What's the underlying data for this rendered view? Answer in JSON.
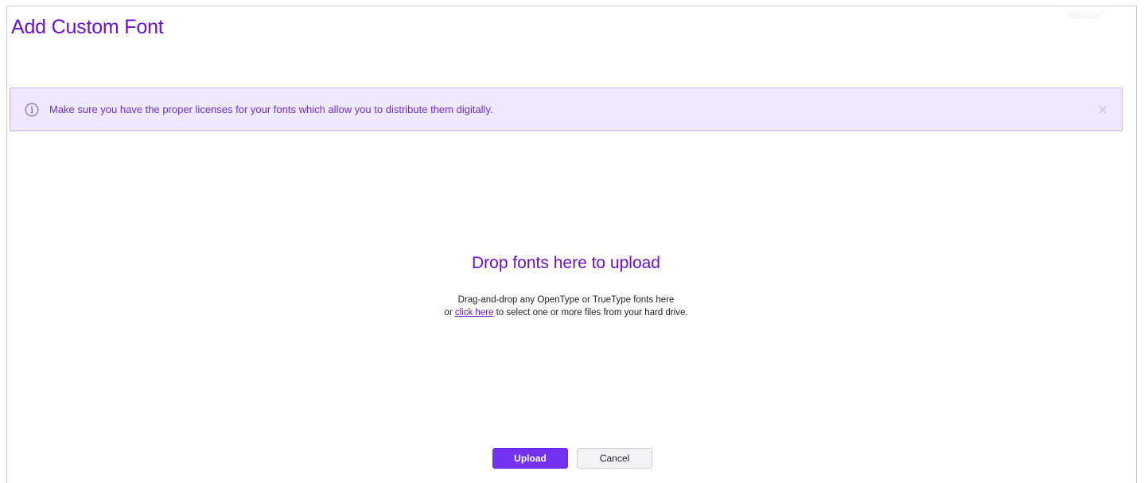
{
  "dialog": {
    "title": "Add Custom Font"
  },
  "alert": {
    "icon": "info-circle-icon",
    "message": "Make sure you have the proper licenses for your fonts which allow you to distribute them digitally.",
    "close_icon": "close-icon"
  },
  "drop_zone": {
    "title": "Drop fonts here to upload",
    "line1": "Drag-and-drop any OpenType or TrueType fonts here",
    "line2_prefix": "or ",
    "link_text": "click here",
    "line2_suffix": " to select one or more files from your hard drive."
  },
  "buttons": {
    "upload": "Upload",
    "cancel": "Cancel"
  },
  "colors": {
    "accent": "#6a0fd8",
    "primary_button": "#7331f2",
    "alert_background": "#efe9fd",
    "alert_border": "#c4b2f2"
  }
}
